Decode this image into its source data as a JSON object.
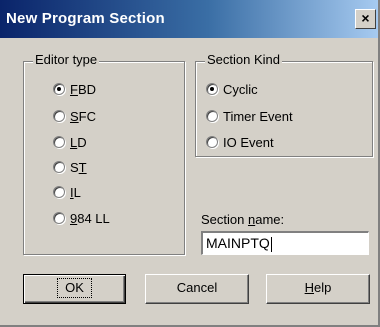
{
  "window": {
    "title": "New Program Section",
    "close_label": "×"
  },
  "editor_type": {
    "group_label": "Editor type",
    "options": [
      {
        "pre": "",
        "u": "F",
        "post": "BD",
        "checked": true
      },
      {
        "pre": "",
        "u": "S",
        "post": "FC",
        "checked": false
      },
      {
        "pre": "",
        "u": "L",
        "post": "D",
        "checked": false
      },
      {
        "pre": "S",
        "u": "T",
        "post": "",
        "checked": false
      },
      {
        "pre": "",
        "u": "I",
        "post": "L",
        "checked": false
      },
      {
        "pre": "",
        "u": "9",
        "post": "84 LL",
        "checked": false
      }
    ]
  },
  "section_kind": {
    "group_label": "Section Kind",
    "options": [
      {
        "label": "Cyclic",
        "checked": true
      },
      {
        "label": "Timer Event",
        "checked": false
      },
      {
        "label": "IO Event",
        "checked": false
      }
    ]
  },
  "section_name": {
    "pre": "Section ",
    "u": "n",
    "post": "ame:",
    "value": "MAINPTQ"
  },
  "buttons": {
    "ok": "OK",
    "cancel": "Cancel",
    "help": {
      "pre": "",
      "u": "H",
      "post": "elp"
    }
  }
}
